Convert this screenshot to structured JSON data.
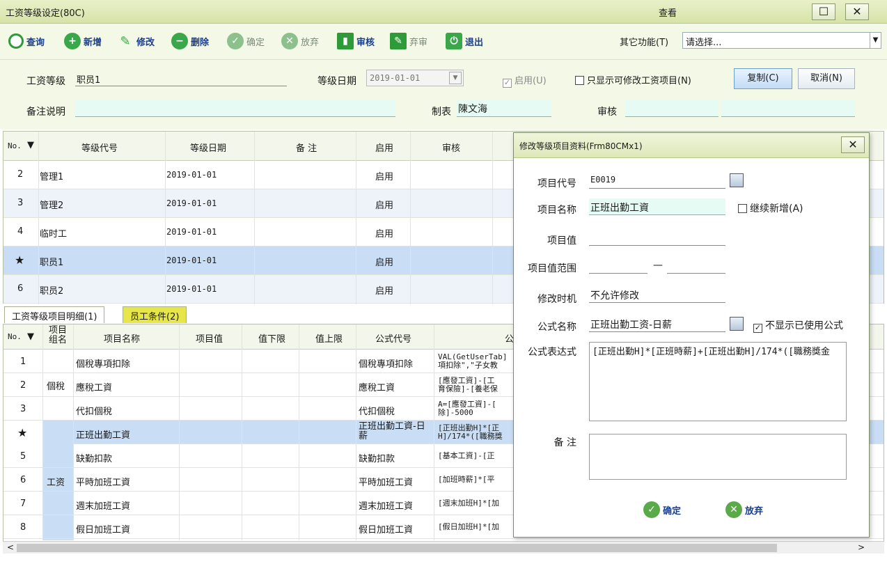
{
  "window": {
    "title": "工资等级设定(80C)",
    "center_title": "查看",
    "maximize": "☐",
    "close": "✕"
  },
  "toolbar": {
    "query": "查询",
    "add": "新增",
    "edit": "修改",
    "delete": "删除",
    "confirm": "确定",
    "discard": "放弃",
    "audit": "审核",
    "unaudit": "弃审",
    "exit": "退出",
    "other_label": "其它功能(T)",
    "other_value": "请选择..."
  },
  "form": {
    "grade_label": "工资等级",
    "grade_value": "职员1",
    "date_label": "等级日期",
    "date_value": "2019-01-01",
    "enable_label": "启用(U)",
    "only_editable_label": "只显示可修改工资项目(N)",
    "copy_button": "复制(C)",
    "cancel_button": "取消(N)",
    "note_label": "备注说明",
    "note_value": "",
    "maker_label": "制表",
    "maker_value": "陳文海",
    "auditor_label": "审核",
    "auditor_value": ""
  },
  "grid1": {
    "headers": {
      "no": "No.",
      "code": "等级代号",
      "date": "等级日期",
      "note": "备 注",
      "enable": "启用",
      "audit": "审核"
    },
    "rows": [
      {
        "no": "2",
        "code": "管理1",
        "date": "2019-01-01",
        "enable": "启用"
      },
      {
        "no": "3",
        "code": "管理2",
        "date": "2019-01-01",
        "enable": "启用"
      },
      {
        "no": "4",
        "code": "临时工",
        "date": "2019-01-01",
        "enable": "启用"
      },
      {
        "no": "★",
        "code": "职员1",
        "date": "2019-01-01",
        "enable": "启用"
      },
      {
        "no": "6",
        "code": "职员2",
        "date": "2019-01-01",
        "enable": "启用"
      }
    ]
  },
  "tabs": {
    "detail": "工资等级项目明细(1)",
    "staff": "员工条件(2)"
  },
  "grid2": {
    "headers": {
      "no": "No.",
      "group": "项目组名",
      "name": "项目名称",
      "value": "项目值",
      "low": "值下限",
      "high": "值上限",
      "formula_code": "公式代号",
      "formula": "公"
    },
    "groups": {
      "tax": "個稅",
      "wage": "工资"
    },
    "rows": [
      {
        "no": "1",
        "name": "個稅專項扣除",
        "fcode": "個稅專項扣除",
        "f1": "VAL(GetUserTab]",
        "f2": "項扣除\",\"子女教"
      },
      {
        "no": "2",
        "name": "應稅工資",
        "fcode": "應稅工資",
        "f1": "[應發工資]-[工",
        "f2": "育保險]-[養老保"
      },
      {
        "no": "3",
        "name": "代扣個稅",
        "fcode": "代扣個稅",
        "f1": "A=[應發工資]-[",
        "f2": "除]-5000"
      },
      {
        "no": "★",
        "name": "正班出勤工資",
        "fcode": "正班出勤工資-日薪",
        "f1": "[正班出勤H]*[正",
        "f2": "H]/174*([職務獎"
      },
      {
        "no": "5",
        "name": "缺勤扣款",
        "fcode": "缺勤扣款",
        "f1": "[基本工資]-[正",
        "f2": ""
      },
      {
        "no": "6",
        "name": "平時加班工資",
        "fcode": "平時加班工資",
        "f1": "[加班時薪]*[平",
        "f2": ""
      },
      {
        "no": "7",
        "name": "週末加班工資",
        "fcode": "週末加班工資",
        "f1": "[週末加班H]*[加",
        "f2": ""
      },
      {
        "no": "8",
        "name": "假日加班工資",
        "fcode": "假日加班工資",
        "f1": "[假日加班H]*[加",
        "f2": ""
      }
    ]
  },
  "dialog": {
    "title": "修改等级项目资料(Frm80CMx1)",
    "code_label": "项目代号",
    "code_value": "E0019",
    "name_label": "项目名称",
    "name_value": "正班出勤工資",
    "continue_label": "继续新增(A)",
    "value_label": "项目值",
    "value_value": "",
    "range_label": "项目值范围",
    "range_dash": "—",
    "modify_label": "修改时机",
    "modify_value": "不允许修改",
    "formula_label": "公式名称",
    "formula_value": "正班出勤工资-日薪",
    "hide_used_label": "不显示已使用公式",
    "expr_label": "公式表达式",
    "expr_value": "[正班出勤H]*[正班時薪]+[正班出勤H]/174*([職務獎金",
    "note_label": "备 注",
    "note_value": "",
    "ok": "确定",
    "cancel": "放弃"
  },
  "scrollbar": {
    "left": "<",
    "right": ">"
  }
}
